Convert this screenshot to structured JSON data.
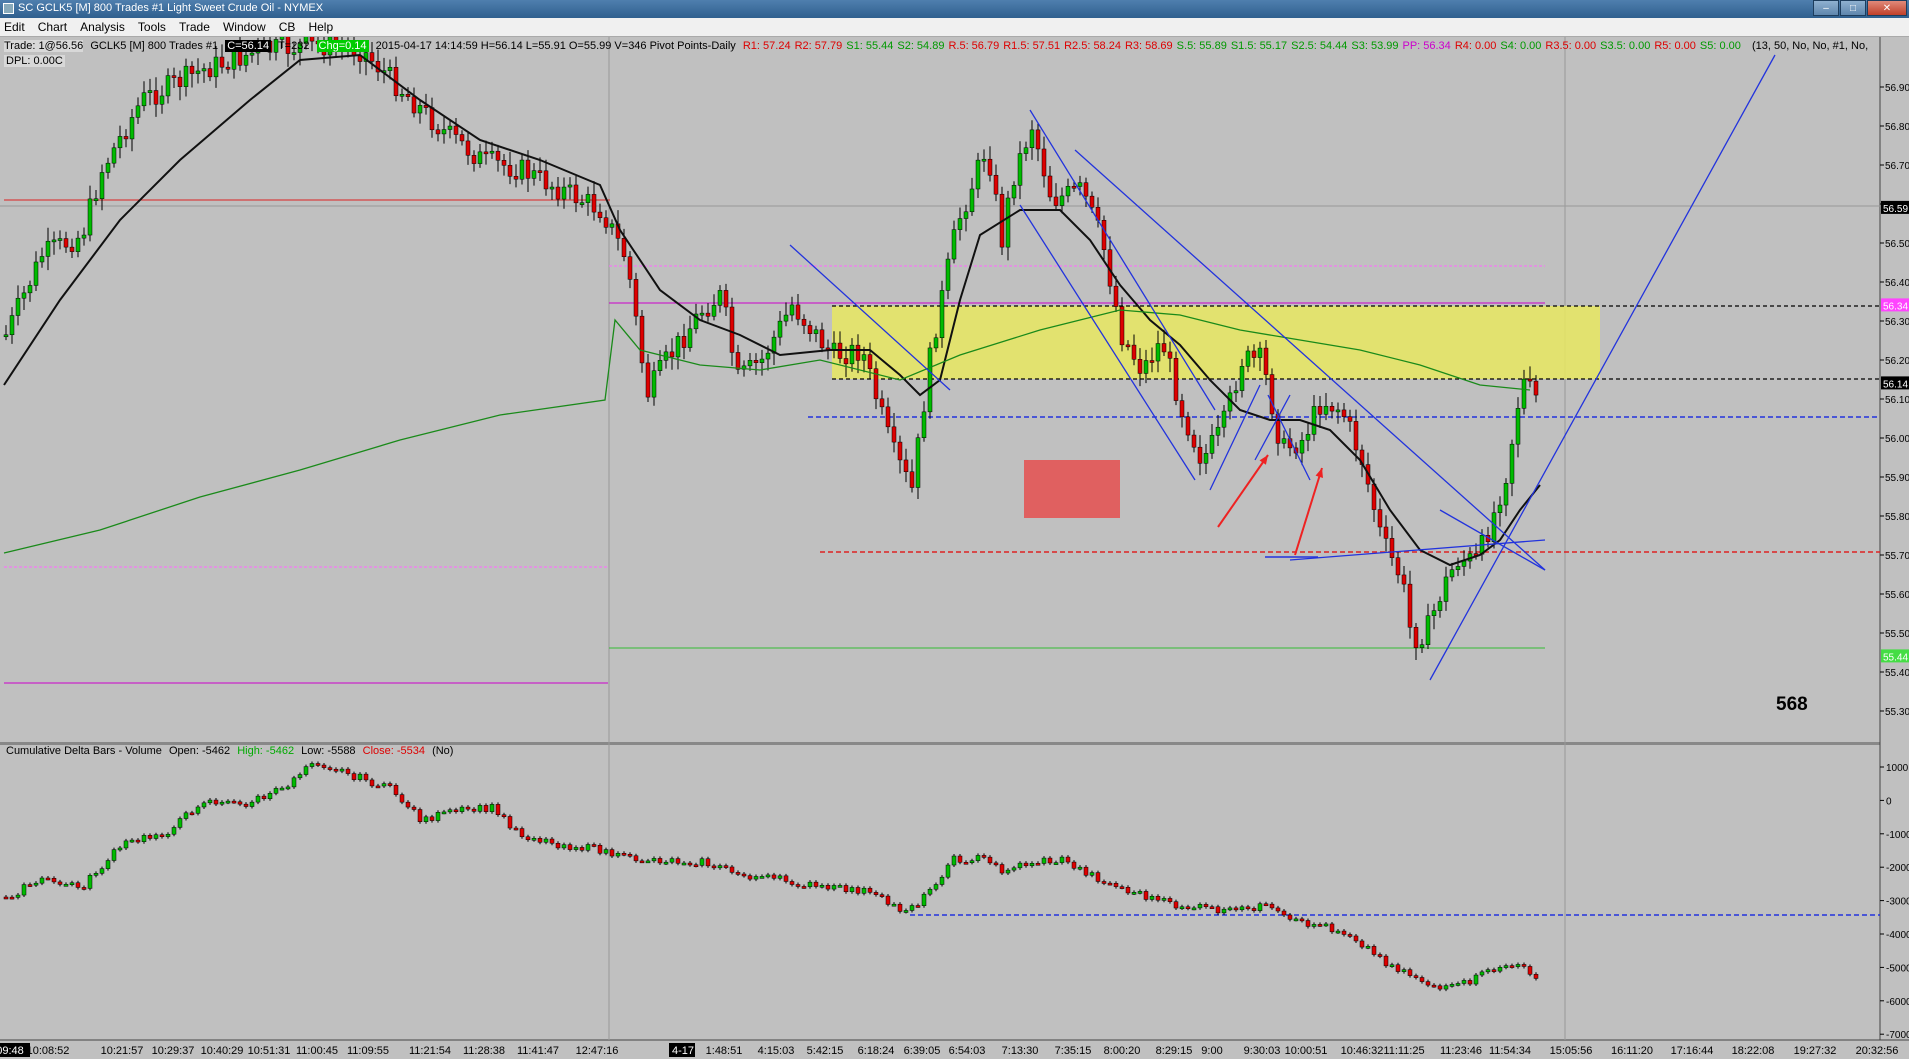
{
  "window": {
    "title": "SC GCLK5 [M]  800 Trades  #1  Light Sweet Crude Oil - NYMEX"
  },
  "menu": [
    "Edit",
    "Chart",
    "Analysis",
    "Tools",
    "Trade",
    "Window",
    "CB",
    "Help"
  ],
  "header": {
    "trade": "Trade: 1@56.56",
    "symbol": "GCLK5 [M]  800 Trades  #1",
    "current": "C=56.14",
    "ticks": "T=232",
    "chg": "Chg=0.14",
    "ohlc": "2015-04-17 14:14:59 H=56.14 L=55.91 O=55.99 V=346 Pivot Points-Daily",
    "pivots": [
      {
        "text": "R1: 57.24",
        "color": "#dd0000"
      },
      {
        "text": "R2: 57.79",
        "color": "#dd0000"
      },
      {
        "text": "S1: 55.44",
        "color": "#009900"
      },
      {
        "text": "S2: 54.89",
        "color": "#009900"
      },
      {
        "text": "R.5: 56.79",
        "color": "#dd0000"
      },
      {
        "text": "R1.5: 57.51",
        "color": "#dd0000"
      },
      {
        "text": "R2.5: 58.24",
        "color": "#dd0000"
      },
      {
        "text": "R3: 58.69",
        "color": "#dd0000"
      },
      {
        "text": "S.5: 55.89",
        "color": "#009900"
      },
      {
        "text": "S1.5: 55.17",
        "color": "#009900"
      },
      {
        "text": "S2.5: 54.44",
        "color": "#009900"
      },
      {
        "text": "S3: 53.99",
        "color": "#009900"
      },
      {
        "text": "PP: 56.34",
        "color": "#cc00cc"
      },
      {
        "text": "R4: 0.00",
        "color": "#dd0000"
      },
      {
        "text": "S4: 0.00",
        "color": "#009900"
      },
      {
        "text": "R3.5: 0.00",
        "color": "#dd0000"
      },
      {
        "text": "S3.5: 0.00",
        "color": "#009900"
      },
      {
        "text": "R5: 0.00",
        "color": "#dd0000"
      },
      {
        "text": "S5: 0.00",
        "color": "#009900"
      }
    ],
    "params": "(13, 50, No, No, #1, No,",
    "dpl": "DPL: 0.00C"
  },
  "lower_panel": {
    "name": "Cumulative Delta Bars - Volume",
    "open": "Open: -5462",
    "high": "High: -5462",
    "low": "Low: -5588",
    "close": "Close: -5534",
    "flag": "(No)"
  },
  "annotation_number": "568",
  "price_axis": [
    "56.90",
    "56.80",
    "56.70",
    "56.60",
    "56.50",
    "56.40",
    "56.30",
    "56.20",
    "56.10",
    "56.00",
    "55.90",
    "55.80",
    "55.70",
    "55.60",
    "55.50",
    "55.40",
    "55.30"
  ],
  "price_markers": [
    {
      "text": "56.59",
      "price": 56.59,
      "bg": "#000000",
      "fg": "#ffffff"
    },
    {
      "text": "56.34",
      "price": 56.34,
      "bg": "#ff44ff",
      "fg": "#ffffff"
    },
    {
      "text": "56.14",
      "price": 56.14,
      "bg": "#000000",
      "fg": "#ffffff"
    },
    {
      "text": "55.44",
      "price": 55.44,
      "bg": "#44dd44",
      "fg": "#ffffff"
    }
  ],
  "delta_axis": [
    "1000",
    "0",
    "-1000",
    "-2000",
    "-3000",
    "-4000",
    "-5000",
    "-6000",
    "-7000"
  ],
  "time_axis": [
    "09:48",
    "10:08:52",
    "10:21:57",
    "10:29:37",
    "10:40:29",
    "10:51:31",
    "11:00:45",
    "11:09:55",
    "11:21:54",
    "11:28:38",
    "11:41:47",
    "12:47:16",
    "4-17",
    "1:48:51",
    "4:15:03",
    "5:42:15",
    "6:18:24",
    "6:39:05",
    "6:54:03",
    "7:13:30",
    "7:35:15",
    "8:00:20",
    "8:29:15",
    "9:00",
    "9:30:03",
    "10:00:51",
    "10:46:32",
    "11:11:25",
    "11:23:46",
    "11:54:34",
    "15:05:56",
    "16:11:20",
    "17:16:44",
    "18:22:08",
    "19:27:32",
    "20:32:56"
  ],
  "colors": {
    "up": "#00bb00",
    "down": "#dd0000",
    "zone": "#e8e860",
    "trend": "#2233dd"
  }
}
